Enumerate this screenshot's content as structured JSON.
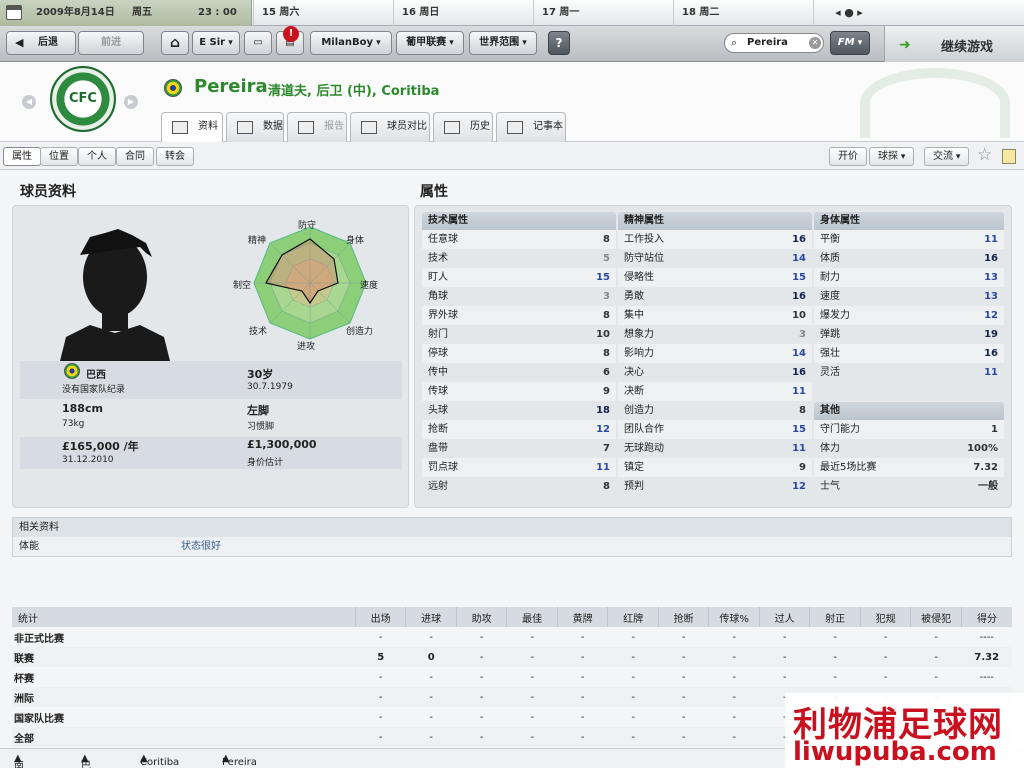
{
  "calendar": {
    "date": "2009年8月14日",
    "weekday": "周五",
    "time": "23 : 00",
    "days": [
      "15 周六",
      "16 周日",
      "17 周一",
      "18 周二"
    ]
  },
  "nav": {
    "back": "后退",
    "forward": "前进",
    "manager": "E Sir",
    "notification_count": "!",
    "user": "MilanBoy",
    "league": "葡甲联赛",
    "world": "世界范围",
    "help": "?",
    "search_value": "Pereira",
    "fm": "FM",
    "continue": "继续游戏"
  },
  "player": {
    "name": "Pereira",
    "desc": "清道夫, 后卫 (中), Coritiba",
    "club_crest": "CFC"
  },
  "tabs": [
    "资料",
    "数据",
    "报告",
    "球员对比",
    "历史",
    "记事本"
  ],
  "subtabs": [
    "属性",
    "位置",
    "个人",
    "合同",
    "转会"
  ],
  "actions": {
    "offer": "开价",
    "scout": "球探",
    "interact": "交流"
  },
  "profile": {
    "title": "球员资料",
    "radar_labels": [
      "防守",
      "身体",
      "速度",
      "创造力",
      "进攻",
      "技术",
      "制空",
      "精神"
    ],
    "nation": "巴西",
    "intl": "没有国家队纪录",
    "age": "30岁",
    "dob": "30.7.1979",
    "height": "188cm",
    "weight": "73kg",
    "foot": "左脚",
    "foot_label": "习惯脚",
    "wage": "£165,000 /年",
    "contract_end": "31.12.2010",
    "value": "£1,300,000",
    "value_label": "身价估计"
  },
  "attributes": {
    "title": "属性",
    "technical": {
      "title": "技术属性",
      "items": [
        {
          "n": "任意球",
          "v": "8",
          "c": "dark"
        },
        {
          "n": "技术",
          "v": "5",
          "c": "gray"
        },
        {
          "n": "盯人",
          "v": "15",
          "c": "blue"
        },
        {
          "n": "角球",
          "v": "3",
          "c": "gray"
        },
        {
          "n": "界外球",
          "v": "8",
          "c": "dark"
        },
        {
          "n": "射门",
          "v": "10",
          "c": "dark"
        },
        {
          "n": "停球",
          "v": "8",
          "c": "dark"
        },
        {
          "n": "传中",
          "v": "6",
          "c": "dark"
        },
        {
          "n": "传球",
          "v": "9",
          "c": "dark"
        },
        {
          "n": "头球",
          "v": "18",
          "c": "navy"
        },
        {
          "n": "抢断",
          "v": "12",
          "c": "blue"
        },
        {
          "n": "盘带",
          "v": "7",
          "c": "dark"
        },
        {
          "n": "罚点球",
          "v": "11",
          "c": "blue"
        },
        {
          "n": "远射",
          "v": "8",
          "c": "dark"
        }
      ]
    },
    "mental": {
      "title": "精神属性",
      "items": [
        {
          "n": "工作投入",
          "v": "16",
          "c": "navy"
        },
        {
          "n": "防守站位",
          "v": "14",
          "c": "blue"
        },
        {
          "n": "侵略性",
          "v": "15",
          "c": "blue"
        },
        {
          "n": "勇敢",
          "v": "16",
          "c": "navy"
        },
        {
          "n": "集中",
          "v": "10",
          "c": "dark"
        },
        {
          "n": "想象力",
          "v": "3",
          "c": "gray"
        },
        {
          "n": "影响力",
          "v": "14",
          "c": "blue"
        },
        {
          "n": "决心",
          "v": "16",
          "c": "navy"
        },
        {
          "n": "决断",
          "v": "11",
          "c": "blue"
        },
        {
          "n": "创造力",
          "v": "8",
          "c": "dark"
        },
        {
          "n": "团队合作",
          "v": "15",
          "c": "blue"
        },
        {
          "n": "无球跑动",
          "v": "11",
          "c": "blue"
        },
        {
          "n": "镇定",
          "v": "9",
          "c": "dark"
        },
        {
          "n": "预判",
          "v": "12",
          "c": "blue"
        }
      ]
    },
    "physical": {
      "title": "身体属性",
      "items": [
        {
          "n": "平衡",
          "v": "11",
          "c": "blue"
        },
        {
          "n": "体质",
          "v": "16",
          "c": "navy"
        },
        {
          "n": "耐力",
          "v": "13",
          "c": "blue"
        },
        {
          "n": "速度",
          "v": "13",
          "c": "blue"
        },
        {
          "n": "爆发力",
          "v": "12",
          "c": "blue"
        },
        {
          "n": "弹跳",
          "v": "19",
          "c": "navy"
        },
        {
          "n": "强壮",
          "v": "16",
          "c": "navy"
        },
        {
          "n": "灵活",
          "v": "11",
          "c": "blue"
        }
      ]
    },
    "other": {
      "title": "其他",
      "items": [
        {
          "n": "守门能力",
          "v": "1"
        },
        {
          "n": "体力",
          "v": "100%"
        },
        {
          "n": "最近5场比赛",
          "v": "7.32"
        },
        {
          "n": "士气",
          "v": "一般"
        }
      ]
    }
  },
  "related": {
    "title": "相关资料",
    "label": "体能",
    "value": "状态很好"
  },
  "stats": {
    "headers": [
      "统计",
      "出场",
      "进球",
      "助攻",
      "最佳",
      "黄牌",
      "红牌",
      "抢断",
      "传球%",
      "过人",
      "射正",
      "犯规",
      "被侵犯",
      "得分"
    ],
    "rows": [
      [
        "非正式比赛",
        "-",
        "-",
        "-",
        "-",
        "-",
        "-",
        "-",
        "-",
        "-",
        "-",
        "-",
        "-",
        "----"
      ],
      [
        "联赛",
        "5",
        "0",
        "-",
        "-",
        "-",
        "-",
        "-",
        "-",
        "-",
        "-",
        "-",
        "-",
        "7.32"
      ],
      [
        "杯赛",
        "-",
        "-",
        "-",
        "-",
        "-",
        "-",
        "-",
        "-",
        "-",
        "-",
        "-",
        "-",
        "----"
      ],
      [
        "洲际",
        "-",
        "-",
        "-",
        "-",
        "-",
        "-",
        "-",
        "-",
        "-",
        "-",
        "-",
        "-",
        ""
      ],
      [
        "国家队比赛",
        "-",
        "-",
        "-",
        "-",
        "-",
        "-",
        "-",
        "-",
        "-",
        "-",
        "-",
        "-",
        ""
      ],
      [
        "全部",
        "-",
        "-",
        "-",
        "-",
        "-",
        "-",
        "-",
        "-",
        "-",
        "-",
        "-",
        "-",
        ""
      ]
    ]
  },
  "footer": [
    "南美洲",
    "巴西",
    "Coritiba",
    "Pereira"
  ],
  "watermark": {
    "line1": "利物浦足球网",
    "line2": "liwupuba.com"
  }
}
